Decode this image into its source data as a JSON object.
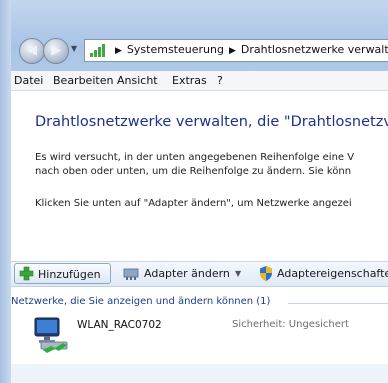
{
  "address_bar": {
    "crumbs": [
      "Systemsteuerung",
      "Drahtlosnetzwerke verwalte"
    ],
    "separator": "▶"
  },
  "menu": [
    "Datei",
    "Bearbeiten",
    "Ansicht",
    "Extras",
    "?"
  ],
  "main": {
    "title": "Drahtlosnetzwerke verwalten, die \"Drahtlosnetzv",
    "paragraph_1_line_1": "Es wird versucht, in der unten angegebenen Reihenfolge eine V",
    "paragraph_1_line_2": "nach oben oder unten, um die Reihenfolge zu ändern. Sie könn",
    "paragraph_2": "Klicken Sie unten auf \"Adapter ändern\", um Netzwerke angezei"
  },
  "toolbar": {
    "add_label": "Hinzufügen",
    "adapter_label": "Adapter ändern",
    "adapter_props_label": "Adaptereigenschafte"
  },
  "group": {
    "label": "Netzwerke, die Sie anzeigen und ändern können (1)"
  },
  "networks": [
    {
      "name": "WLAN_RAC0702",
      "security": "Sicherheit: Ungesichert"
    }
  ],
  "icons": {
    "back": "back-arrow-icon",
    "forward": "forward-arrow-icon",
    "address": "network-bars-icon",
    "add": "plus-icon",
    "adapter": "network-adapter-icon",
    "props": "shield-icon",
    "network": "wireless-network-icon"
  }
}
